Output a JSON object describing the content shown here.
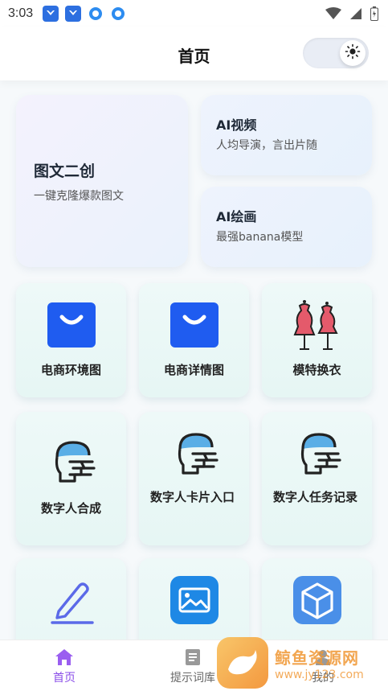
{
  "status_bar": {
    "time": "3:03"
  },
  "header": {
    "title": "首页"
  },
  "feature_cards": {
    "remix": {
      "title": "图文二创",
      "subtitle": "一键克隆爆款图文"
    },
    "video": {
      "title": "AI视频",
      "subtitle": "人均导演，言出片随"
    },
    "draw": {
      "title": "AI绘画",
      "subtitle": "最强banana模型"
    }
  },
  "tiles": [
    {
      "label": "电商环境图",
      "icon": "shopping-bag-icon"
    },
    {
      "label": "电商详情图",
      "icon": "shopping-bag-icon"
    },
    {
      "label": "模特换衣",
      "icon": "mannequin-icon"
    },
    {
      "label": "数字人合成",
      "icon": "digital-human-icon"
    },
    {
      "label": "数字人卡片入口",
      "icon": "digital-human-icon"
    },
    {
      "label": "数字人任务记录",
      "icon": "digital-human-icon"
    },
    {
      "label": "",
      "icon": "pencil-icon"
    },
    {
      "label": "",
      "icon": "image-icon"
    },
    {
      "label": "",
      "icon": "cube-icon"
    }
  ],
  "bottom_nav": [
    {
      "label": "首页",
      "icon": "home-icon",
      "active": true
    },
    {
      "label": "提示词库",
      "icon": "document-icon",
      "active": false
    },
    {
      "label": "我的",
      "icon": "user-icon",
      "active": false
    }
  ],
  "watermark": {
    "name": "鲸鱼资源网",
    "url": "www.jy123.com"
  },
  "colors": {
    "accent": "#8a4ee8",
    "bag_blue": "#1f5cf0",
    "tile_bg": "#e9f7f5"
  }
}
